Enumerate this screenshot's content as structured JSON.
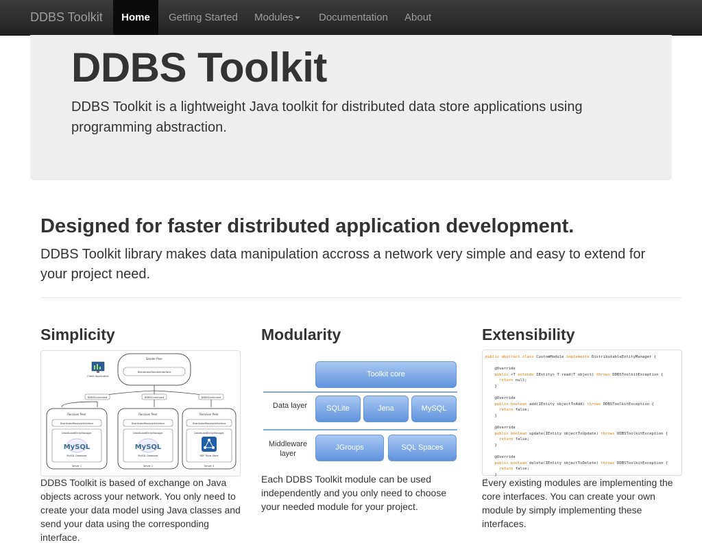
{
  "nav": {
    "brand": "DDBS Toolkit",
    "items": [
      {
        "label": "Home",
        "active": true
      },
      {
        "label": "Getting Started"
      },
      {
        "label": "Modules"
      },
      {
        "label": "Documentation"
      },
      {
        "label": "About"
      }
    ]
  },
  "hero": {
    "title": "DDBS Toolkit",
    "text": "DDBS Toolkit is a lightweight Java toolkit for distributed data store applications using programming abstraction."
  },
  "main": {
    "heading": "Designed for faster distributed application development.",
    "lead": "DDBS Toolkit library makes data manipulation accross a network very simple and easy to extend for your project need."
  },
  "columns": [
    {
      "title": "Simplicity",
      "text": "DDBS Toolkit is based of exchange on Java objects across your network. You only need to create your data model using Java classes and send your data using the corresponding interface."
    },
    {
      "title": "Modularity",
      "text": "Each DDBS Toolkit module can be used independently and you only need to choose your needed module for your project."
    },
    {
      "title": "Extensibility",
      "text": "Every existing modules are implementing the core interfaces. You can create your own module by simply implementing these interfaces."
    }
  ],
  "simplicity_diagram": {
    "sender": "Sender Peer",
    "sender_iface": "DistributedSenderInterface",
    "client": "Client Application",
    "commands": [
      "DDBSCommand",
      "DDBSCommand",
      "DDBSCommand"
    ],
    "receiver": "Receiver Peer",
    "receiver_iface": "DistributedReceiverInterface",
    "entity_manager": "DistributedEntityManager",
    "servers": [
      {
        "label": "Server 1",
        "db_logo": "MySQL",
        "db": "MySQL Database"
      },
      {
        "label": "Server 2",
        "db_logo": "MySQL",
        "db": "MySQL Database"
      },
      {
        "label": "Server 3",
        "db_logo": "",
        "db": "RDF Triple Store"
      }
    ]
  },
  "modularity_diagram": {
    "core": "Toolkit core",
    "data_layer": "Data layer",
    "middleware_layer": "Middleware layer",
    "data_modules": [
      "SQLite",
      "Jena",
      "MySQL"
    ],
    "middleware_modules": [
      "JGroups",
      "SQL Spaces"
    ]
  },
  "code": {
    "l1a": "public abstract class",
    "l1b": " CustomModule ",
    "l1c": "implements",
    "l1d": " DistributableEntityManager {",
    "override": "@Override",
    "m1a": "public",
    "m1b": " <T ",
    "m1c": "extends",
    "m1d": " IEntity> T read(T object) ",
    "m1e": "throws",
    "m1f": " DDBSToolkitException {",
    "m1r1": "return",
    "m1r2": " null;",
    "m2a": "public boolean",
    "m2b": " add(IEntity objectToAdd) ",
    "m2c": "throws",
    "m2d": " DDBSToolkitException {",
    "ret": "return",
    "false": " false;",
    "m3b": " update(IEntity objectToUpdate) ",
    "m4b": " delete(IEntity objectToDelete) ",
    "close": "}"
  }
}
